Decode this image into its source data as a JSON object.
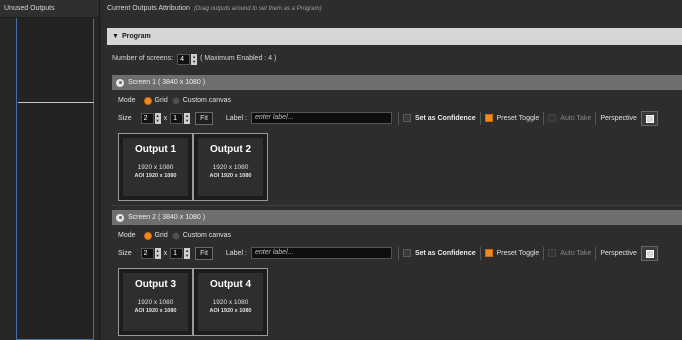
{
  "left_panel": {
    "title": "Unused Outputs"
  },
  "header": {
    "title": "Current Outputs Attribution",
    "hint": "(Drag outputs around to set them as a Program)"
  },
  "program": {
    "label": "Program",
    "num_screens_label": "Number of screens:",
    "num_screens_value": "4",
    "max_enabled": "( Maximum Enabled : 4 )"
  },
  "screens": [
    {
      "title": "Screen 1  ( 3840 x 1080 )",
      "mode_label": "Mode",
      "grid_label": "Grid",
      "custom_label": "Custom canvas",
      "size_label": "Size",
      "cols": "2",
      "times": "x",
      "rows": "1",
      "fit_label": "Fit",
      "label_label": "Label :",
      "label_placeholder": "enter label...",
      "confidence_label": "Set as Confidence",
      "preset_label": "Preset Toggle",
      "autotake_label": "Auto Take",
      "perspective_label": "Perspective",
      "outputs": [
        {
          "name": "Output 1",
          "res": "1920 x 1080",
          "aoi": "AOI 1920 x 1080"
        },
        {
          "name": "Output 2",
          "res": "1920 x 1080",
          "aoi": "AOI 1920 x 1080"
        }
      ]
    },
    {
      "title": "Screen 2  ( 3840 x 1080 )",
      "mode_label": "Mode",
      "grid_label": "Grid",
      "custom_label": "Custom canvas",
      "size_label": "Size",
      "cols": "2",
      "times": "x",
      "rows": "1",
      "fit_label": "Fit",
      "label_label": "Label :",
      "label_placeholder": "enter label...",
      "confidence_label": "Set as Confidence",
      "preset_label": "Preset Toggle",
      "autotake_label": "Auto Take",
      "perspective_label": "Perspective",
      "outputs": [
        {
          "name": "Output 3",
          "res": "1920 x 1080",
          "aoi": "AOI 1920 x 1080"
        },
        {
          "name": "Output 4",
          "res": "1920 x 1080",
          "aoi": "AOI 1920 x 1080"
        }
      ]
    }
  ],
  "colors": {
    "accent": "#f08a1e",
    "screen_bar": "#6e6e6e",
    "program_bar": "#d6d6d6"
  }
}
